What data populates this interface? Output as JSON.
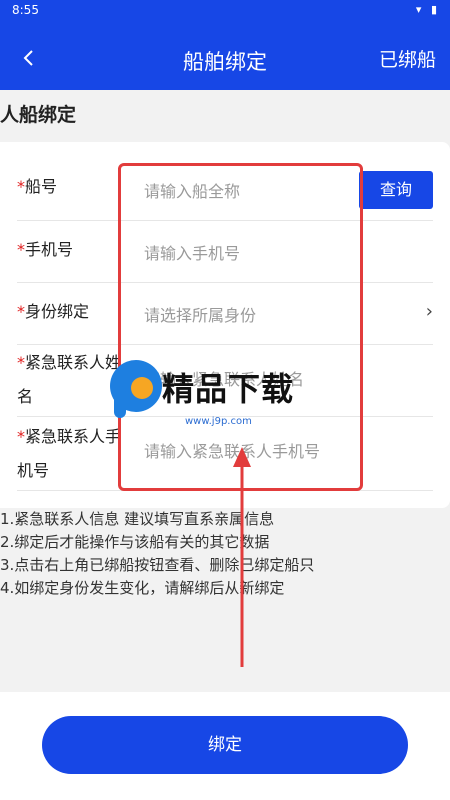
{
  "status_bar": {
    "time": "8:55",
    "icons": "▾ ▮"
  },
  "header": {
    "title": "船舶绑定",
    "right_action": "已绑船"
  },
  "section": {
    "title": "人船绑定"
  },
  "form": {
    "required_mark": "*",
    "ship_no": {
      "label": "船号",
      "placeholder": "请输入船全称",
      "button": "查询"
    },
    "phone": {
      "label": "手机号",
      "placeholder": "请输入手机号"
    },
    "identity": {
      "label": "身份绑定",
      "placeholder": "请选择所属身份"
    },
    "emergency_name": {
      "label_line1": "紧急联系人姓",
      "label_line2": "名",
      "placeholder": "请输入紧急联系人姓名"
    },
    "emergency_phone": {
      "label_line1": "紧急联系人手",
      "label_line2": "机号",
      "placeholder": "请输入紧急联系人手机号"
    }
  },
  "notes": [
    "1.紧急联系人信息 建议填写直系亲属信息",
    "2.绑定后才能操作与该船有关的其它数据",
    "3.点击右上角已绑船按钮查看、删除已绑定船只",
    "4.如绑定身份发生变化，请解绑后从新绑定"
  ],
  "footer": {
    "bind_button": "绑定"
  },
  "watermark": {
    "brand": "精品下载",
    "url": "www.j9p.com"
  },
  "colors": {
    "primary": "#1747e6",
    "required": "#e02020",
    "highlight": "#e23c3c"
  }
}
